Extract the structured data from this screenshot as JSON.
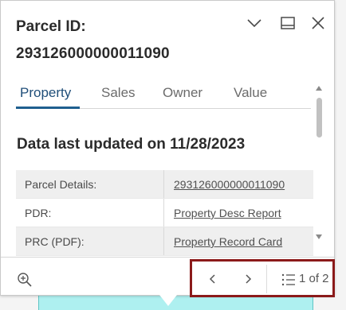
{
  "popup": {
    "title_label": "Parcel ID:",
    "title_value": "293126000000011090"
  },
  "tabs": [
    {
      "label": "Property",
      "active": true
    },
    {
      "label": "Sales",
      "active": false
    },
    {
      "label": "Owner",
      "active": false
    },
    {
      "label": "Value",
      "active": false
    }
  ],
  "updated_text": "Data last updated on 11/28/2023",
  "rows": [
    {
      "label": "Parcel Details:",
      "value": "293126000000011090"
    },
    {
      "label": "PDR:",
      "value": "Property Desc Report"
    },
    {
      "label": "PRC (PDF):",
      "value": "Property Record Card"
    }
  ],
  "pagination": {
    "count_text": "1 of 2"
  },
  "icons": {
    "collapse": "chevron-down-icon",
    "dock": "dock-icon",
    "close": "close-icon",
    "zoom": "zoom-to-icon",
    "prev": "chevron-left-icon",
    "next": "chevron-right-icon",
    "list": "list-icon"
  },
  "colors": {
    "active_tab": "#1f4e79",
    "pager_border": "#8b1a1a",
    "map_water": "#aef0f0"
  }
}
